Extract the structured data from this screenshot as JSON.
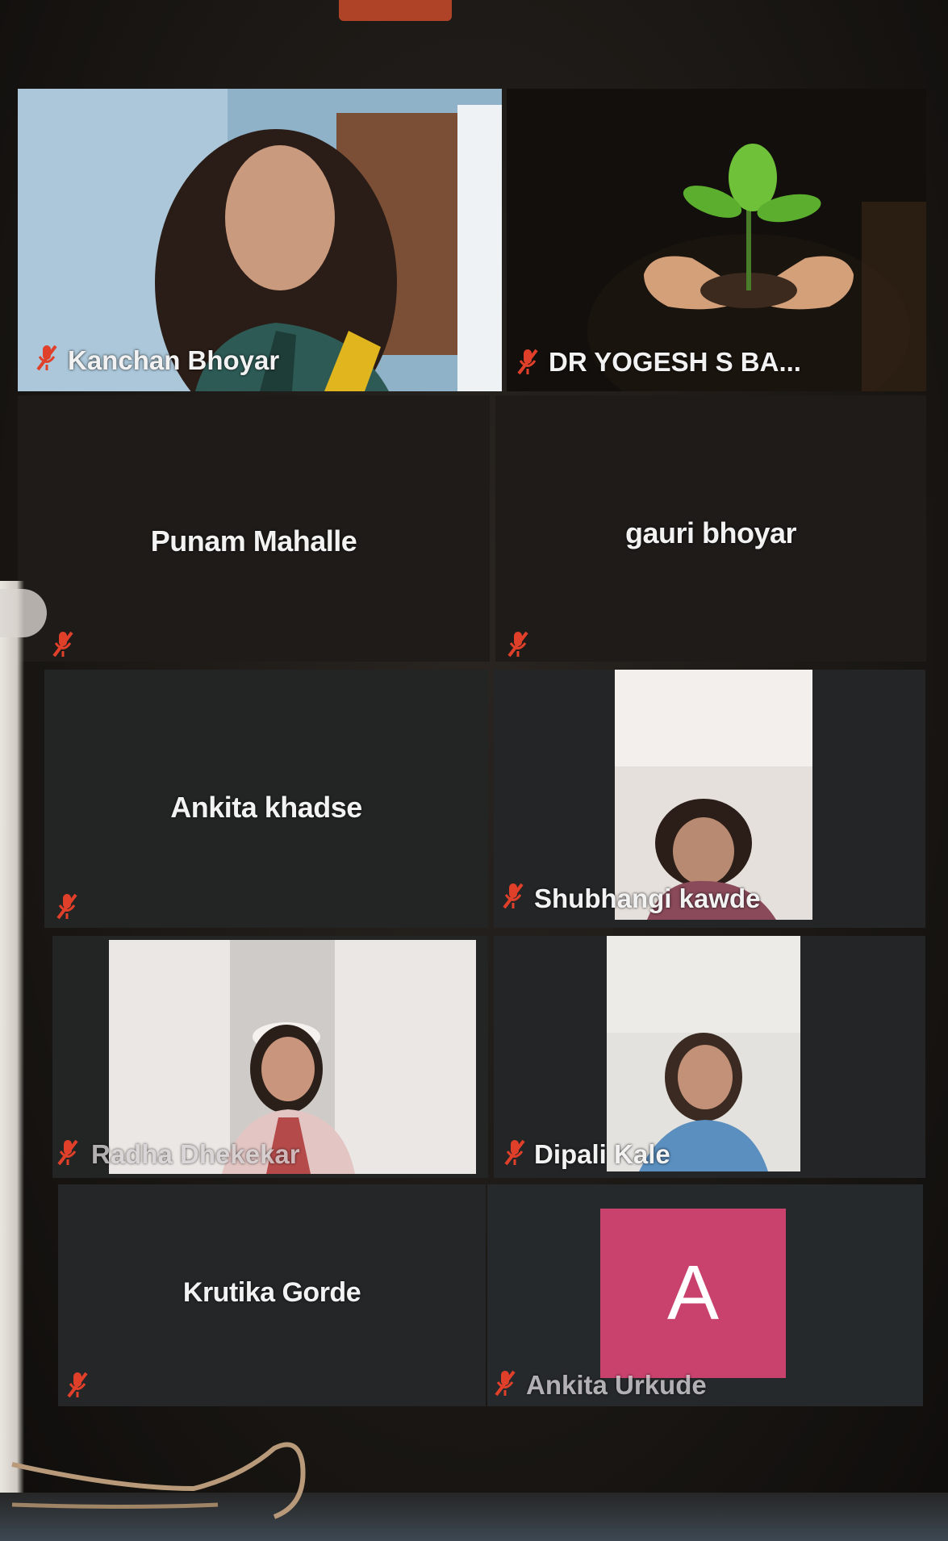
{
  "participants": {
    "kanchan": {
      "name": "Kanchan Bhoyar",
      "muted": true
    },
    "yogesh": {
      "name": "DR YOGESH S BA...",
      "muted": true
    },
    "punam": {
      "name": "Punam Mahalle",
      "muted": true
    },
    "gauri": {
      "name": "gauri bhoyar",
      "muted": true
    },
    "ankita_k": {
      "name": "Ankita khadse",
      "muted": true
    },
    "shubhangi": {
      "name": "Shubhangi kawde",
      "muted": true
    },
    "radha": {
      "name": "Radha Dhekekar",
      "muted": true
    },
    "dipali": {
      "name": "Dipali Kale",
      "muted": true
    },
    "krutika": {
      "name": "Krutika Gorde",
      "muted": true
    },
    "ankita_u": {
      "name": "Ankita Urkude",
      "muted": true,
      "avatar_letter": "A"
    }
  },
  "colors": {
    "tile_bg": "#232323",
    "mic_muted": "#e0402a",
    "avatar_bg": "#c9426e"
  },
  "icons": {
    "muted_mic": "microphone-muted-icon"
  }
}
